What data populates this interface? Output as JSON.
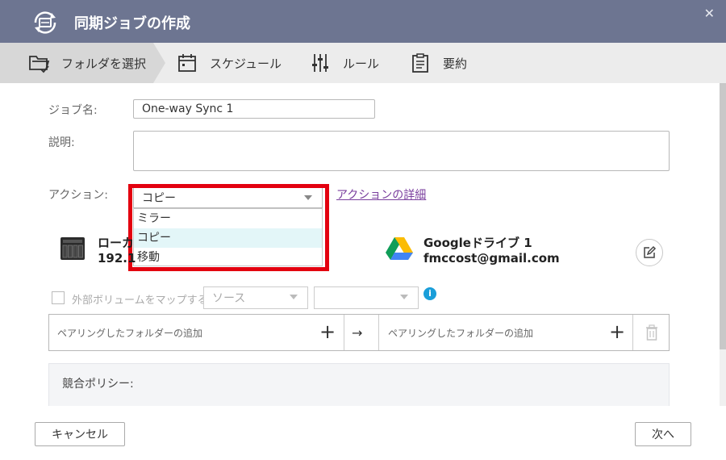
{
  "window": {
    "title": "同期ジョブの作成",
    "close_symbol": "✕"
  },
  "steps": [
    {
      "label": "フォルダを選択",
      "icon": "folder-check-icon",
      "active": true
    },
    {
      "label": "スケジュール",
      "icon": "calendar-icon"
    },
    {
      "label": "ルール",
      "icon": "sliders-icon"
    },
    {
      "label": "要約",
      "icon": "clipboard-icon"
    }
  ],
  "form": {
    "job_name_label": "ジョブ名:",
    "job_name_value": "One-way Sync 1",
    "description_label": "説明:",
    "description_value": "",
    "action_label": "アクション:",
    "action_selected": "コピー",
    "action_options": [
      "ミラー",
      "コピー",
      "移動"
    ],
    "action_details_link": "アクションの詳細"
  },
  "local": {
    "title_partial": "ローカ",
    "ip_partial": "192.1"
  },
  "remote": {
    "title": "Googleドライブ 1",
    "account": "fmccost@gmail.com"
  },
  "mapping": {
    "checkbox_label": "外部ボリュームをマップする",
    "source_placeholder": "ソース",
    "target_placeholder": "",
    "info_symbol": "i"
  },
  "pair": {
    "left_label": "ペアリングしたフォルダーの追加",
    "right_label": "ペアリングしたフォルダーの追加",
    "plus": "+",
    "arrow": "→"
  },
  "policy": {
    "title": "競合ポリシー:"
  },
  "footer": {
    "cancel": "キャンセル",
    "next": "次へ"
  },
  "colors": {
    "titlebar": "#6d7591",
    "highlight": "#e3000f",
    "link": "#7a3f9e",
    "info": "#1a9ed9"
  }
}
